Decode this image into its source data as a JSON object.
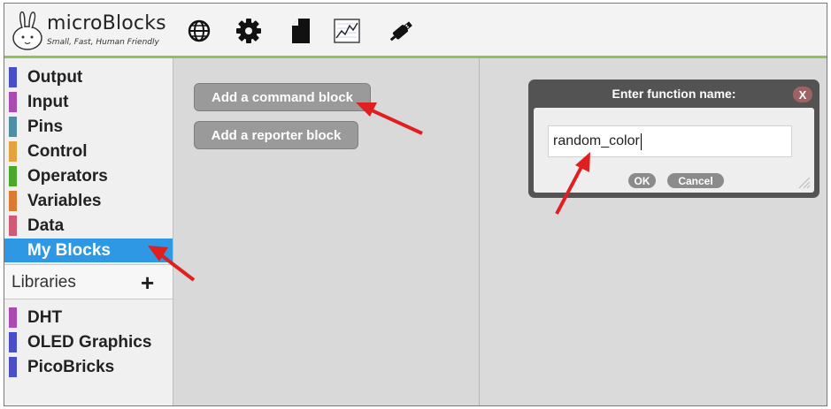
{
  "app": {
    "title": "microBlocks",
    "tagline": "Small, Fast, Human Friendly"
  },
  "toolbar": {
    "icons": [
      "globe-icon",
      "gear-icon",
      "file-icon",
      "graph-icon",
      "usb-plug-icon"
    ]
  },
  "sidebar": {
    "categories": [
      {
        "label": "Output",
        "color": "#4a4fc9"
      },
      {
        "label": "Input",
        "color": "#a94bb0"
      },
      {
        "label": "Pins",
        "color": "#4f8ea4"
      },
      {
        "label": "Control",
        "color": "#e3a33c"
      },
      {
        "label": "Operators",
        "color": "#4ca82b"
      },
      {
        "label": "Variables",
        "color": "#de7a2f"
      },
      {
        "label": "Data",
        "color": "#d05a75"
      },
      {
        "label": "My Blocks",
        "color": "#8f8f8f",
        "selected": true
      }
    ],
    "libraries_label": "Libraries",
    "libraries_add": "+",
    "libraries": [
      {
        "label": "DHT",
        "color": "#a94bb0"
      },
      {
        "label": "OLED Graphics",
        "color": "#4a4fc9"
      },
      {
        "label": "PicoBricks",
        "color": "#4a4fc9"
      }
    ]
  },
  "palette": {
    "add_command_label": "Add a command block",
    "add_reporter_label": "Add a reporter block"
  },
  "dialog": {
    "title": "Enter function name:",
    "close_label": "X",
    "input_value": "random_color",
    "ok_label": "OK",
    "cancel_label": "Cancel"
  },
  "colors": {
    "accent_bar": "#8fc25a",
    "selection": "#2f98e4",
    "annotation_arrow": "#e02020"
  }
}
